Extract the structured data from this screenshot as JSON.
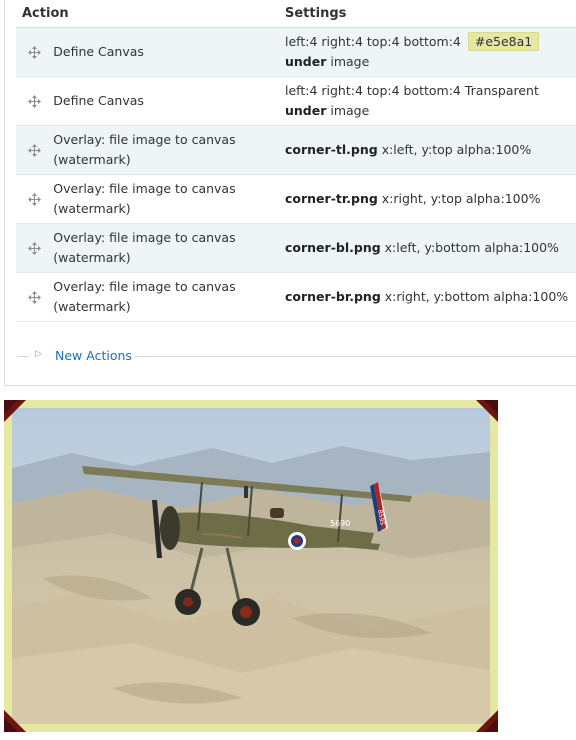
{
  "table": {
    "headers": {
      "action": "Action",
      "settings": "Settings"
    },
    "rows": [
      {
        "action": "Define Canvas",
        "settings": {
          "pre": "left:4 right:4 top:4 bottom:4",
          "color": "#e5e8a1",
          "bold": "under",
          "post": "image"
        }
      },
      {
        "action": "Define Canvas",
        "settings": {
          "pre": "left:4 right:4 top:4 bottom:4 Transparent",
          "bold": "under",
          "post": "image"
        }
      },
      {
        "action_line1": "Overlay: file image to canvas",
        "action_line2": "(watermark)",
        "settings": {
          "file": "corner-tl.png",
          "rest": "x:left, y:top alpha:100%"
        }
      },
      {
        "action_line1": "Overlay: file image to canvas",
        "action_line2": "(watermark)",
        "settings": {
          "file": "corner-tr.png",
          "rest": "x:right, y:top alpha:100%"
        }
      },
      {
        "action_line1": "Overlay: file image to canvas",
        "action_line2": "(watermark)",
        "settings": {
          "file": "corner-bl.png",
          "rest": "x:left, y:bottom alpha:100%"
        }
      },
      {
        "action_line1": "Overlay: file image to canvas",
        "action_line2": "(watermark)",
        "settings": {
          "file": "corner-br.png",
          "rest": "x:right, y:bottom alpha:100%"
        }
      }
    ]
  },
  "new_actions": {
    "label": "New Actions"
  },
  "icons": {
    "drag": "drag-handle-icon",
    "expand": "triangle-right-icon"
  },
  "colors": {
    "canvas_swatch": "#e5e8a1",
    "corner": "#6b1515",
    "link": "#1f6fb8"
  },
  "preview": {
    "aircraft_roundel_number": "5690",
    "tail_number": "B595"
  }
}
